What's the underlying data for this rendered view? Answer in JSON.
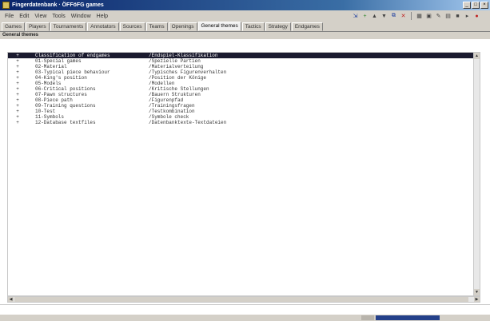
{
  "window": {
    "title": "Fingerdatenbank · ÖFFöFG games"
  },
  "menu": [
    "File",
    "Edit",
    "View",
    "Tools",
    "Window",
    "Help"
  ],
  "tabs": [
    "Games",
    "Players",
    "Tournaments",
    "Annotators",
    "Sources",
    "Teams",
    "Openings",
    "General themes",
    "Tactics",
    "Strategy",
    "Endgames"
  ],
  "active_tab": "General themes",
  "subheader": "General themes",
  "table": {
    "header": {
      "name": "Classification of endgames",
      "path": "/Endspiel-Klassifikation"
    },
    "rows": [
      {
        "icon": "+",
        "name": "01-Special games",
        "path": "/Spezielle Partien"
      },
      {
        "icon": "+",
        "name": "02-Material",
        "path": "/Materialverteilung"
      },
      {
        "icon": "+",
        "name": "03-Typical piece behaviour",
        "path": "/Typisches Figurenverhalten"
      },
      {
        "icon": "+",
        "name": "04-King's position",
        "path": "/Position der Könige"
      },
      {
        "icon": "+",
        "name": "05-Models",
        "path": "/Modellen"
      },
      {
        "icon": "+",
        "name": "06-Critical positions",
        "path": "/Kritische Stellungen"
      },
      {
        "icon": "+",
        "name": "07-Pawn structures",
        "path": "/Bauern Strukturen"
      },
      {
        "icon": "+",
        "name": "08-Piece path",
        "path": "/Figurenpfad"
      },
      {
        "icon": "+",
        "name": "09-Training questions",
        "path": "/Trainingsfragen"
      },
      {
        "icon": "+",
        "name": "10-Test",
        "path": "/Testkombination"
      },
      {
        "icon": "+",
        "name": "11-Symbols",
        "path": "/Symbole check"
      },
      {
        "icon": "+",
        "name": "12-Database textfiles",
        "path": "/Datenbanktexte-Textdateien"
      }
    ]
  },
  "colors": {
    "titlebar": "#0a246a",
    "header_row": "#1b1b2f",
    "chrome": "#d4d0c8"
  }
}
